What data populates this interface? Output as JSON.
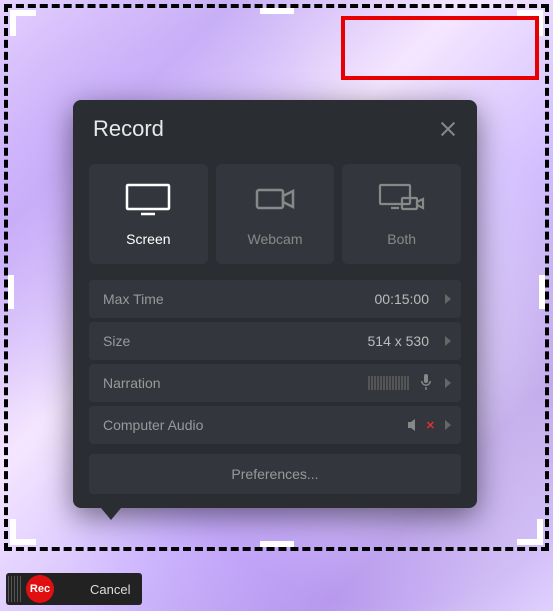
{
  "panel": {
    "title": "Record",
    "modes": {
      "screen": "Screen",
      "webcam": "Webcam",
      "both": "Both"
    },
    "settings": {
      "max_time_label": "Max Time",
      "max_time_value": "00:15:00",
      "size_label": "Size",
      "size_value": "514 x 530",
      "narration_label": "Narration",
      "audio_label": "Computer Audio"
    },
    "preferences_label": "Preferences..."
  },
  "toolbar": {
    "rec_label": "Rec",
    "cancel_label": "Cancel"
  }
}
